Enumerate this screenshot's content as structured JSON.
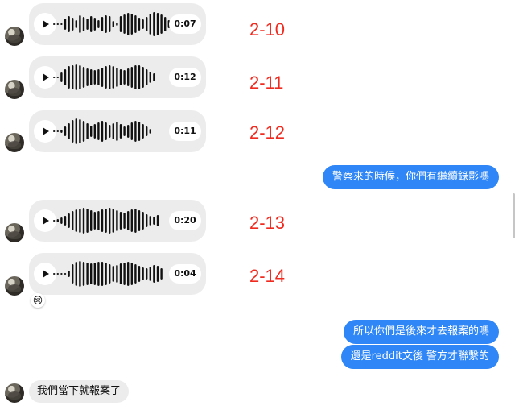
{
  "voice_messages": [
    {
      "duration": "0:07",
      "tag": "2-10"
    },
    {
      "duration": "0:12",
      "tag": "2-11"
    },
    {
      "duration": "0:11",
      "tag": "2-12"
    },
    {
      "duration": "0:20",
      "tag": "2-13"
    },
    {
      "duration": "0:04",
      "tag": "2-14"
    }
  ],
  "outgoing": {
    "msg1": "警察來的時候，你們有繼續錄影嗎",
    "msg2": "所以你們是後來才去報案的嗎",
    "msg3": "還是reddit文後 警方才聯繫的"
  },
  "incoming_text": "我們當下就報案了",
  "reaction_emoji": "😢",
  "colors": {
    "outgoing_bubble": "#2f86f6",
    "tag_red": "#ef2a1f",
    "incoming_bubble": "#ececec"
  }
}
